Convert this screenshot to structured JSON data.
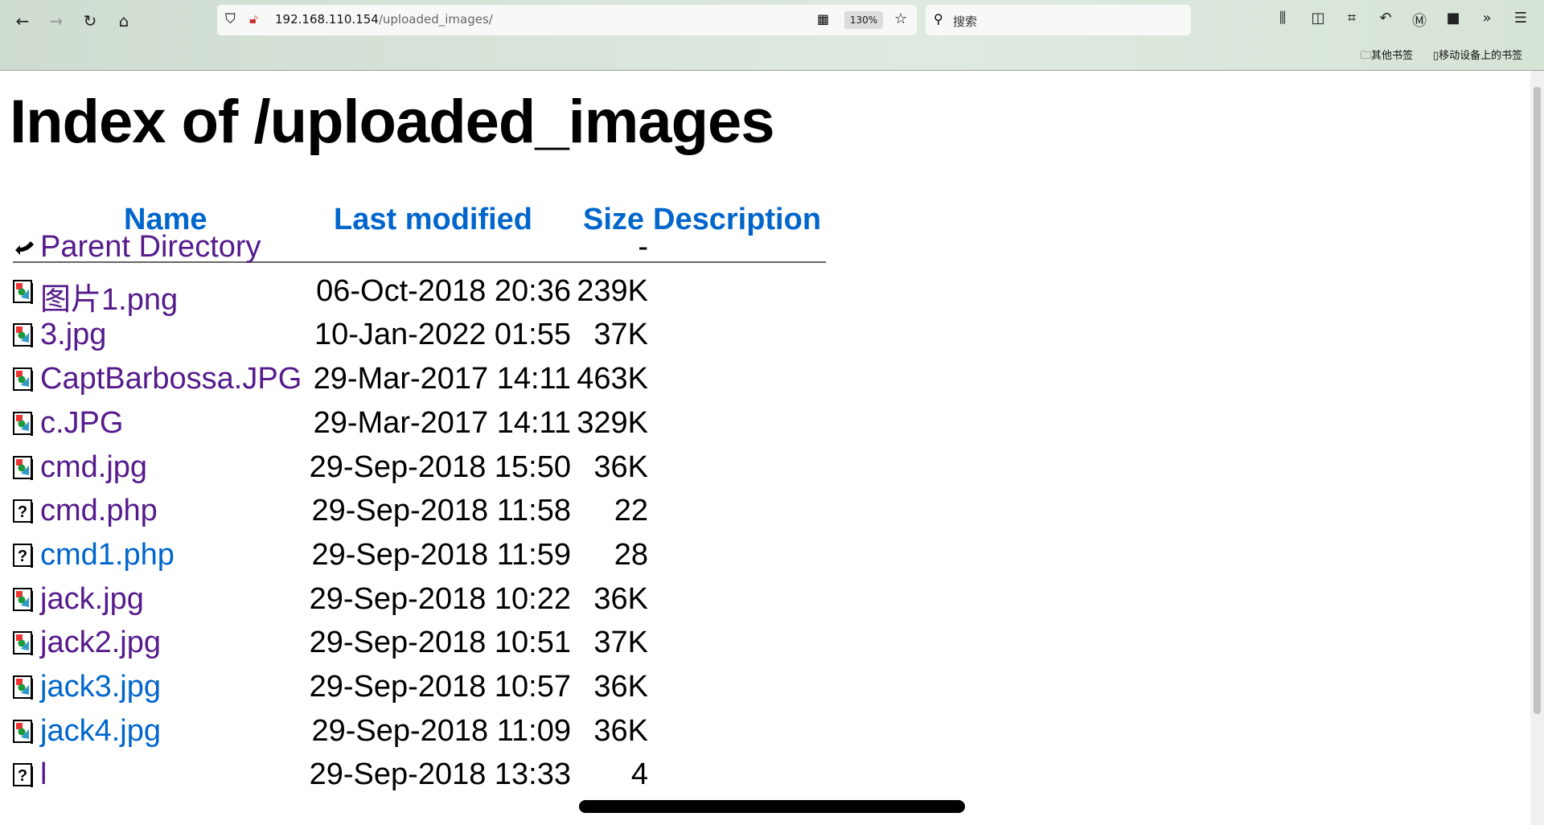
{
  "browser": {
    "url_host": "192.168.110.154",
    "url_path": "/uploaded_images/",
    "zoom": "130%",
    "search_placeholder": "搜索",
    "bookmarks": [
      "其他书签",
      "移动设备上的书签"
    ]
  },
  "page": {
    "title": "Index of /uploaded_images",
    "headers": {
      "name": "Name",
      "modified": "Last modified",
      "size": "Size",
      "description": "Description"
    },
    "rows": [
      {
        "name": "Parent Directory",
        "date": "",
        "size": "-",
        "icon": "back-icon",
        "visited": true
      },
      {
        "name": "图片1.png",
        "date": "06-Oct-2018 20:36",
        "size": "239K",
        "icon": "image-icon",
        "visited": true
      },
      {
        "name": "3.jpg",
        "date": "10-Jan-2022 01:55",
        "size": "37K",
        "icon": "image-icon",
        "visited": true
      },
      {
        "name": "CaptBarbossa.JPG",
        "date": "29-Mar-2017 14:11",
        "size": "463K",
        "icon": "image-icon",
        "visited": true
      },
      {
        "name": "c.JPG",
        "date": "29-Mar-2017 14:11",
        "size": "329K",
        "icon": "image-icon",
        "visited": true
      },
      {
        "name": "cmd.jpg",
        "date": "29-Sep-2018 15:50",
        "size": "36K",
        "icon": "image-icon",
        "visited": true
      },
      {
        "name": "cmd.php",
        "date": "29-Sep-2018 11:58",
        "size": "22",
        "icon": "unknown-file-icon",
        "visited": true
      },
      {
        "name": "cmd1.php",
        "date": "29-Sep-2018 11:59",
        "size": "28",
        "icon": "unknown-file-icon",
        "visited": false
      },
      {
        "name": "jack.jpg",
        "date": "29-Sep-2018 10:22",
        "size": "36K",
        "icon": "image-icon",
        "visited": true
      },
      {
        "name": "jack2.jpg",
        "date": "29-Sep-2018 10:51",
        "size": "37K",
        "icon": "image-icon",
        "visited": true
      },
      {
        "name": "jack3.jpg",
        "date": "29-Sep-2018 10:57",
        "size": "36K",
        "icon": "image-icon",
        "visited": false
      },
      {
        "name": "jack4.jpg",
        "date": "29-Sep-2018 11:09",
        "size": "36K",
        "icon": "image-icon",
        "visited": false
      },
      {
        "name": "l",
        "date": "29-Sep-2018 13:33",
        "size": "4",
        "icon": "unknown-file-icon",
        "visited": true
      }
    ]
  },
  "colors": {
    "link": "#0066cc",
    "visited": "#551a8b"
  }
}
